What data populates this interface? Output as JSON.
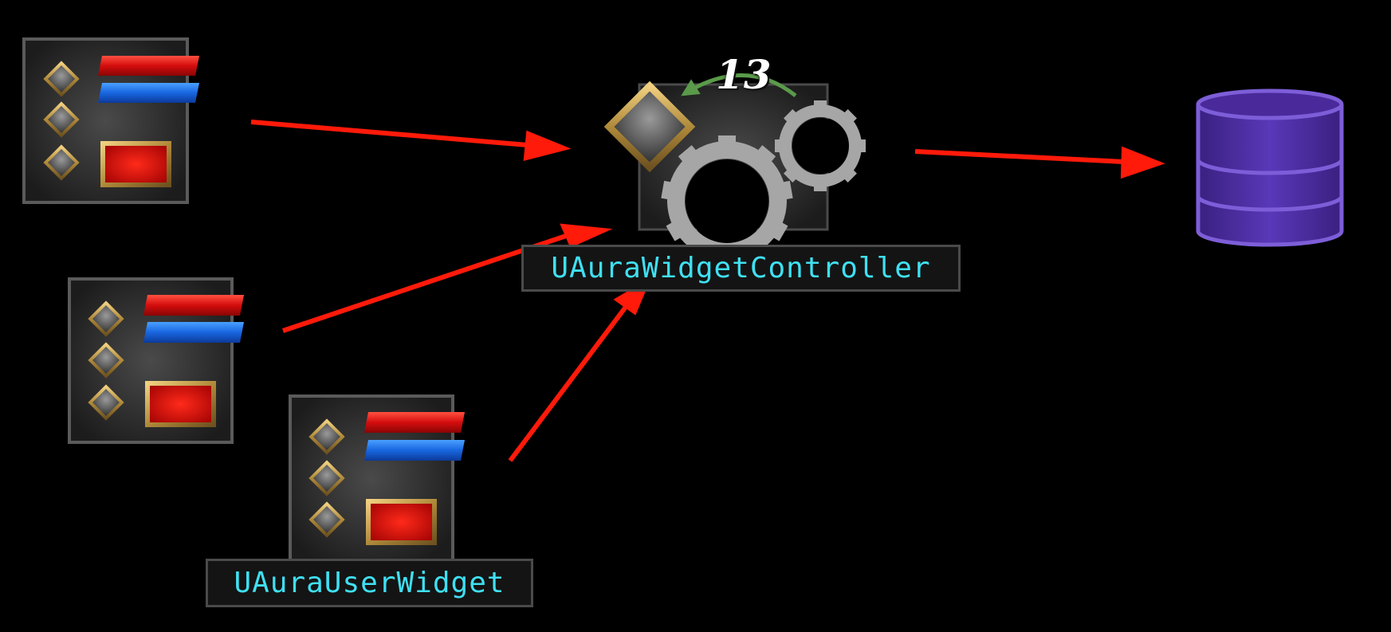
{
  "diagram": {
    "controller": {
      "label": "UAuraWidgetController"
    },
    "widget": {
      "label": "UAuraUserWidget"
    },
    "cycle_count": "13",
    "colors": {
      "arrow": "#ff1a0a",
      "label_text": "#3fe0f2",
      "database": "#4a2a9a",
      "database_edge": "#7d5ed8",
      "gold": "#c9a24a",
      "gear": "#a6a6a6",
      "cycle_arrow": "#5a9a4a"
    }
  }
}
